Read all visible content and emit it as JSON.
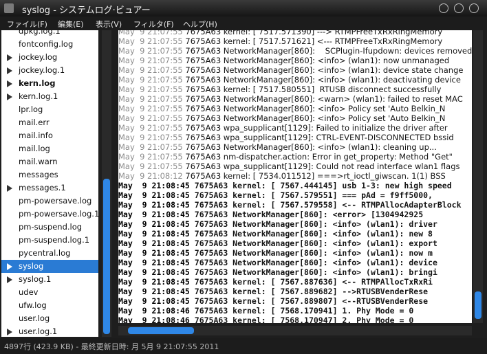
{
  "window": {
    "title": "syslog - システムログ·ビュアー"
  },
  "menu": [
    "ファイル(F)",
    "編集(E)",
    "表示(V)",
    "フィルタ(F)",
    "ヘルプ(H)"
  ],
  "files": [
    {
      "label": "dpkg.log.1",
      "expander": false,
      "bold": false,
      "selected": false
    },
    {
      "label": "fontconfig.log",
      "expander": false,
      "bold": false,
      "selected": false
    },
    {
      "label": "jockey.log",
      "expander": true,
      "bold": false,
      "selected": false
    },
    {
      "label": "jockey.log.1",
      "expander": true,
      "bold": false,
      "selected": false
    },
    {
      "label": "kern.log",
      "expander": true,
      "bold": true,
      "selected": false
    },
    {
      "label": "kern.log.1",
      "expander": true,
      "bold": false,
      "selected": false
    },
    {
      "label": "lpr.log",
      "expander": false,
      "bold": false,
      "selected": false
    },
    {
      "label": "mail.err",
      "expander": false,
      "bold": false,
      "selected": false
    },
    {
      "label": "mail.info",
      "expander": false,
      "bold": false,
      "selected": false
    },
    {
      "label": "mail.log",
      "expander": false,
      "bold": false,
      "selected": false
    },
    {
      "label": "mail.warn",
      "expander": false,
      "bold": false,
      "selected": false
    },
    {
      "label": "messages",
      "expander": false,
      "bold": false,
      "selected": false
    },
    {
      "label": "messages.1",
      "expander": true,
      "bold": false,
      "selected": false
    },
    {
      "label": "pm-powersave.log",
      "expander": false,
      "bold": false,
      "selected": false
    },
    {
      "label": "pm-powersave.log.1",
      "expander": false,
      "bold": false,
      "selected": false
    },
    {
      "label": "pm-suspend.log",
      "expander": false,
      "bold": false,
      "selected": false
    },
    {
      "label": "pm-suspend.log.1",
      "expander": false,
      "bold": false,
      "selected": false
    },
    {
      "label": "pycentral.log",
      "expander": false,
      "bold": false,
      "selected": false
    },
    {
      "label": "syslog",
      "expander": true,
      "bold": false,
      "selected": true
    },
    {
      "label": "syslog.1",
      "expander": true,
      "bold": false,
      "selected": false
    },
    {
      "label": "udev",
      "expander": false,
      "bold": false,
      "selected": false
    },
    {
      "label": "ufw.log",
      "expander": false,
      "bold": false,
      "selected": false
    },
    {
      "label": "user.log",
      "expander": false,
      "bold": false,
      "selected": false
    },
    {
      "label": "user.log.1",
      "expander": true,
      "bold": false,
      "selected": false
    }
  ],
  "log_lines": [
    {
      "ts": "May  9 21:07:55",
      "msg": " 7675A63 kernel: [ 7517.571390] ---> RTMPFreeTxRxRingMemory",
      "bold": false
    },
    {
      "ts": "May  9 21:07:55",
      "msg": " 7675A63 kernel: [ 7517.571621] <--- RTMPFreeTxRxRingMemory",
      "bold": false
    },
    {
      "ts": "May  9 21:07:55",
      "msg": " 7675A63 NetworkManager[860]:    SCPlugin-Ifupdown: devices removed",
      "bold": false
    },
    {
      "ts": "May  9 21:07:55",
      "msg": " 7675A63 NetworkManager[860]: <info> (wlan1): now unmanaged",
      "bold": false
    },
    {
      "ts": "May  9 21:07:55",
      "msg": " 7675A63 NetworkManager[860]: <info> (wlan1): device state change",
      "bold": false
    },
    {
      "ts": "May  9 21:07:55",
      "msg": " 7675A63 NetworkManager[860]: <info> (wlan1): deactivating device",
      "bold": false
    },
    {
      "ts": "May  9 21:07:55",
      "msg": " 7675A63 kernel: [ 7517.580551]  RTUSB disconnect successfully",
      "bold": false
    },
    {
      "ts": "May  9 21:07:55",
      "msg": " 7675A63 NetworkManager[860]: <warn> (wlan1): failed to reset MAC",
      "bold": false
    },
    {
      "ts": "May  9 21:07:55",
      "msg": " 7675A63 NetworkManager[860]: <info> Policy set 'Auto Belkin_N",
      "bold": false
    },
    {
      "ts": "May  9 21:07:55",
      "msg": " 7675A63 NetworkManager[860]: <info> Policy set 'Auto Belkin_N",
      "bold": false
    },
    {
      "ts": "May  9 21:07:55",
      "msg": " 7675A63 wpa_supplicant[1129]: Failed to initialize the driver after",
      "bold": false
    },
    {
      "ts": "May  9 21:07:55",
      "msg": " 7675A63 wpa_supplicant[1129]: CTRL-EVENT-DISCONNECTED bssid",
      "bold": false
    },
    {
      "ts": "May  9 21:07:55",
      "msg": " 7675A63 NetworkManager[860]: <info> (wlan1): cleaning up...",
      "bold": false
    },
    {
      "ts": "May  9 21:07:55",
      "msg": " 7675A63 nm-dispatcher.action: Error in get_property: Method \"Get\"",
      "bold": false
    },
    {
      "ts": "May  9 21:07:55",
      "msg": " 7675A63 wpa_supplicant[1129]: Could not read interface wlan1 flags",
      "bold": false
    },
    {
      "ts": "May  9 21:08:12",
      "msg": " 7675A63 kernel: [ 7534.011512] ===>rt_ioctl_giwscan. 1(1) BSS",
      "bold": false
    },
    {
      "ts": "May  9 21:08:45",
      "msg": " 7675A63 kernel: [ 7567.444145] usb 1-3: new high speed",
      "bold": true
    },
    {
      "ts": "May  9 21:08:45",
      "msg": " 7675A63 kernel: [ 7567.579551] === pAd = f9ff5000,",
      "bold": true
    },
    {
      "ts": "May  9 21:08:45",
      "msg": " 7675A63 kernel: [ 7567.579558] <-- RTMPAllocAdapterBlock",
      "bold": true
    },
    {
      "ts": "May  9 21:08:45",
      "msg": " 7675A63 NetworkManager[860]: <error> [1304942925",
      "bold": true
    },
    {
      "ts": "May  9 21:08:45",
      "msg": " 7675A63 NetworkManager[860]: <info> (wlan1): driver",
      "bold": true
    },
    {
      "ts": "May  9 21:08:45",
      "msg": " 7675A63 NetworkManager[860]: <info> (wlan1): new 8",
      "bold": true
    },
    {
      "ts": "May  9 21:08:45",
      "msg": " 7675A63 NetworkManager[860]: <info> (wlan1): export",
      "bold": true
    },
    {
      "ts": "May  9 21:08:45",
      "msg": " 7675A63 NetworkManager[860]: <info> (wlan1): now m",
      "bold": true
    },
    {
      "ts": "May  9 21:08:45",
      "msg": " 7675A63 NetworkManager[860]: <info> (wlan1): device",
      "bold": true
    },
    {
      "ts": "May  9 21:08:45",
      "msg": " 7675A63 NetworkManager[860]: <info> (wlan1): bringi",
      "bold": true
    },
    {
      "ts": "May  9 21:08:45",
      "msg": " 7675A63 kernel: [ 7567.887636] <-- RTMPAllocTxRxRi",
      "bold": true
    },
    {
      "ts": "May  9 21:08:45",
      "msg": " 7675A63 kernel: [ 7567.889682] -->RTUSBVenderRese",
      "bold": true
    },
    {
      "ts": "May  9 21:08:45",
      "msg": " 7675A63 kernel: [ 7567.889807] <--RTUSBVenderRese",
      "bold": true
    },
    {
      "ts": "May  9 21:08:46",
      "msg": " 7675A63 kernel: [ 7568.170941] 1. Phy Mode = 0",
      "bold": true
    },
    {
      "ts": "May  9 21:08:46",
      "msg": " 7675A63 kernel: [ 7568.170947] 2. Phy Mode = 0",
      "bold": true
    }
  ],
  "status": "4897行 (423.9 KB) - 最終更新日時: 月  5月  9 21:07:55 2011",
  "colors": {
    "selection": "#2a7bd4",
    "scroll_thumb": "#2f87e6",
    "chrome": "#1c1c1c"
  }
}
